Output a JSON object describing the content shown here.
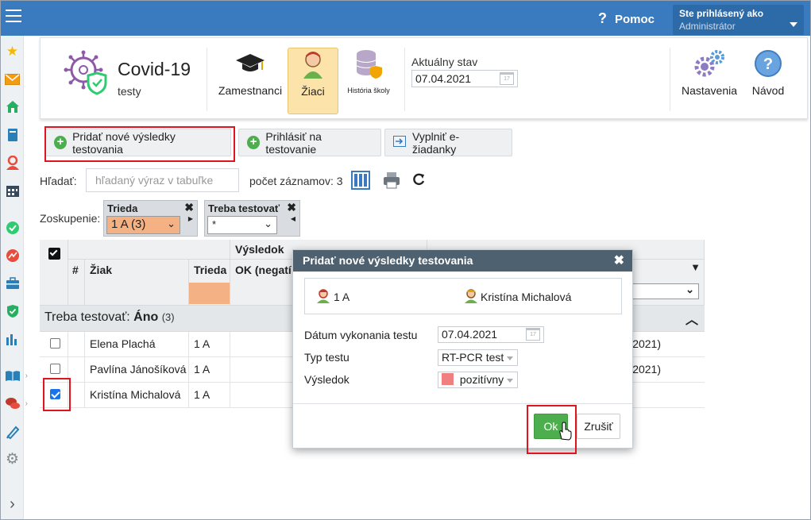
{
  "topbar": {
    "help_label": "Pomoc",
    "user_line1": "Ste prihlásený ako",
    "user_line2": "Administrátor"
  },
  "sidebar": {
    "items": [
      {
        "icon": "star-icon",
        "color": "#f5b800"
      },
      {
        "icon": "mail-icon",
        "color": "#f39c12"
      },
      {
        "icon": "home-icon",
        "color": "#27ae60"
      },
      {
        "icon": "book-icon",
        "color": "#2980b9"
      },
      {
        "icon": "person-icon",
        "color": "#e74c3c"
      },
      {
        "icon": "calendar-icon",
        "color": "#34495e"
      },
      {
        "icon": "check-circle-icon",
        "color": "#2ecc71"
      },
      {
        "icon": "chart-circle-icon",
        "color": "#e74c3c"
      },
      {
        "icon": "briefcase-icon",
        "color": "#2980b9"
      },
      {
        "icon": "shield-check-icon",
        "color": "#27ae60"
      },
      {
        "icon": "bar-chart-icon",
        "color": "#2980b9"
      },
      {
        "icon": "open-book-icon",
        "color": "#2980b9"
      },
      {
        "icon": "chat-icon",
        "color": "#c0392b"
      },
      {
        "icon": "pen-icon",
        "color": "#2980b9"
      },
      {
        "icon": "gear-icon",
        "color": "#7f8c8d"
      },
      {
        "icon": "chevron-right-icon",
        "color": "#555555"
      }
    ]
  },
  "header": {
    "app_title": "Covid-19",
    "app_subtitle": "testy",
    "nav": [
      {
        "label": "Zamestnanci",
        "icon": "graduation-cap-icon"
      },
      {
        "label": "Žiaci",
        "icon": "student-icon",
        "active": true
      },
      {
        "label": "História školy",
        "icon": "database-shield-icon"
      }
    ],
    "state_label": "Aktuálny stav",
    "state_date": "07.04.2021",
    "settings_label": "Nastavenia",
    "help_label": "Návod"
  },
  "toolbar": {
    "add_results": "Pridať nové výsledky testovania",
    "register": "Prihlásiť na testovanie",
    "fill_request": "Vyplniť e-žiadanky"
  },
  "search": {
    "label": "Hľadať:",
    "placeholder": "hľadaný výraz v tabuľke",
    "count_text": "počet záznamov: 3"
  },
  "grouping": {
    "label": "Zoskupenie:",
    "group1_title": "Trieda",
    "group1_value": "1 A (3)",
    "group2_title": "Treba testovať",
    "group2_value": "*"
  },
  "table": {
    "col_hash": "#",
    "col_student": "Žiak",
    "col_class": "Trieda",
    "col_result_top": "Výsledok",
    "col_result_sub": "OK (negatí",
    "group_row_label": "Treba testovať:",
    "group_row_value": "Áno",
    "group_row_count": "(3)",
    "rows": [
      {
        "name": "Elena Plachá",
        "class": "1 A",
        "checked": false,
        "tail": "2021)"
      },
      {
        "name": "Pavlína Jánošíková",
        "class": "1 A",
        "checked": false,
        "tail": "2021)"
      },
      {
        "name": "Kristína Michalová",
        "class": "1 A",
        "checked": true,
        "tail": ""
      }
    ]
  },
  "modal": {
    "title": "Pridať nové výsledky testovania",
    "info_class": "1 A",
    "info_student": "Kristína Michalová",
    "date_label": "Dátum vykonania testu",
    "date_value": "07.04.2021",
    "type_label": "Typ testu",
    "type_value": "RT-PCR test",
    "result_label": "Výsledok",
    "result_value": "pozitívny",
    "result_color": "#f08080",
    "ok_label": "Ok",
    "cancel_label": "Zrušiť"
  }
}
